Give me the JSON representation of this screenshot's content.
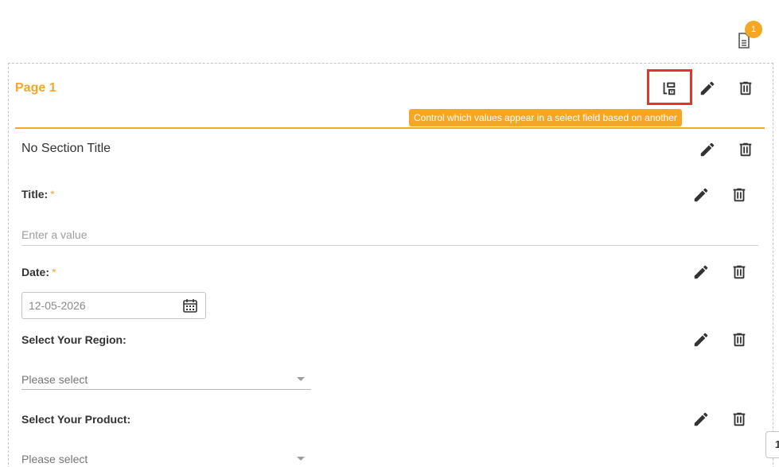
{
  "header": {
    "doc_badge_count": "1"
  },
  "page": {
    "title": "Page 1",
    "tooltip": "Control which values appear in a select field based on another"
  },
  "section": {
    "title": "No Section Title"
  },
  "fields": {
    "title": {
      "label": "Title:",
      "required_mark": "*",
      "placeholder": "Enter a value"
    },
    "date": {
      "label": "Date:",
      "required_mark": "*",
      "value": "12-05-2026"
    },
    "region": {
      "label": "Select Your Region:",
      "value": "Please select"
    },
    "product": {
      "label": "Select Your Product:",
      "value": "Please select"
    }
  },
  "pager": {
    "label": "1"
  },
  "icons": {
    "dependency": "dependency-icon",
    "edit": "pencil-icon",
    "delete": "trash-icon",
    "document": "document-icon",
    "calendar": "calendar-icon"
  },
  "colors": {
    "accent": "#f5a623",
    "highlight": "#e8322a",
    "text": "#333333"
  }
}
